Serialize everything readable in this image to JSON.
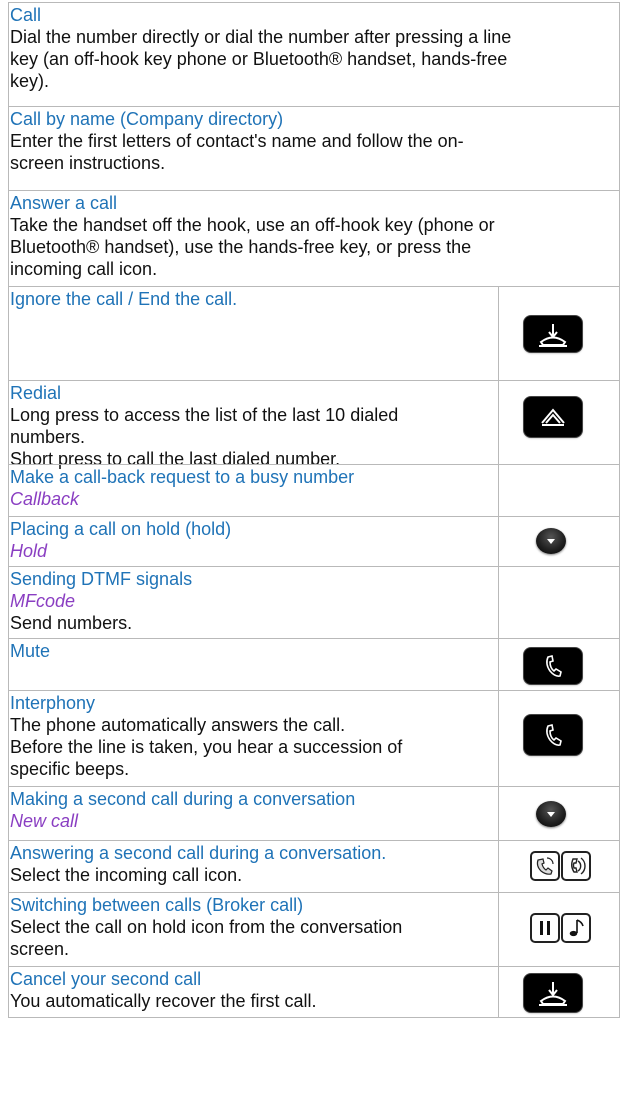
{
  "rows": {
    "call": {
      "title": "Call",
      "lines": [
        "Dial the number directly or dial the number after pressing a line",
        "key (an off-hook key phone or Bluetooth® handset, hands-free",
        "key)."
      ]
    },
    "call_by_name": {
      "title": "Call by name (Company directory)",
      "lines": [
        "Enter the first letters of contact's name and follow the on-",
        "screen instructions."
      ]
    },
    "answer": {
      "title": "Answer a call",
      "lines": [
        "Take the handset off the hook, use an off-hook key (phone or",
        "Bluetooth® handset), use the hands-free key, or press the",
        "incoming call icon."
      ]
    },
    "ignore": {
      "title": "Ignore the call / End the call.",
      "icon": "hang-up-key-icon"
    },
    "redial": {
      "title": "Redial",
      "lines": [
        "Long press to access the list of the last 10 dialed",
        "numbers.",
        "Short press to call the last dialed number."
      ],
      "icon": "redial-key-icon"
    },
    "callback": {
      "title": "Make a call-back request to a busy number",
      "keyword": "Callback"
    },
    "hold": {
      "title": "Placing a call on hold (hold)",
      "keyword": "Hold",
      "icon": "navigator-key-icon"
    },
    "dtmf": {
      "title": "Sending DTMF signals",
      "keyword": "MFcode",
      "lines": [
        "Send numbers."
      ]
    },
    "mute": {
      "title": "Mute",
      "icon": "mute-key-icon"
    },
    "interphony": {
      "title": "Interphony",
      "lines": [
        "The phone automatically answers the call.",
        "Before the line is taken, you hear a succession of",
        "specific beeps."
      ],
      "icon": "interphony-key-icon"
    },
    "second_call": {
      "title": "Making a second call during a conversation",
      "keyword": "New call",
      "icon": "navigator-key-icon"
    },
    "answer_second": {
      "title": "Answering a second call during a conversation.",
      "lines": [
        "Select the incoming call icon."
      ],
      "icon": "incoming-call-icon"
    },
    "broker": {
      "title": "Switching between calls (Broker call)",
      "lines": [
        "Select the call on hold icon from the conversation",
        "screen."
      ],
      "icon": "call-on-hold-icon"
    },
    "cancel_second": {
      "title": "Cancel your second call",
      "lines": [
        "You automatically recover the first call."
      ],
      "icon": "hang-up-key-icon"
    }
  }
}
